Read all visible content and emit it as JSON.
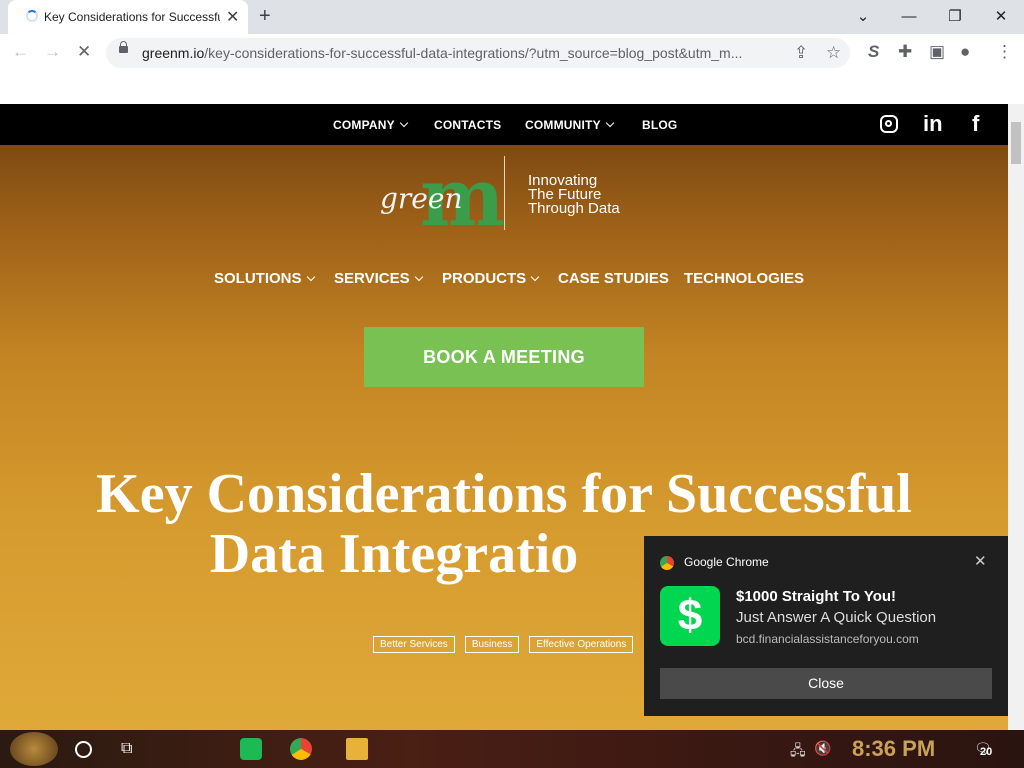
{
  "browser": {
    "tab_title": "Key Considerations for Successful Data Integrations",
    "new_tab": "+",
    "tab_close": "✕",
    "window": {
      "minimize": "—",
      "restore": "❐",
      "close": "✕",
      "tabsearch": "⌄"
    },
    "url_host": "greenm.io",
    "url_path": "/key-considerations-for-successful-data-integrations/?utm_source=blog_post&utm_m..."
  },
  "site": {
    "topnav": {
      "company": "COMPANY",
      "contacts": "CONTACTS",
      "community": "COMMUNITY",
      "blog": "BLOG"
    },
    "logo": {
      "mark": "m",
      "word": "green",
      "tagline": [
        "Innovating",
        "The Future",
        "Through Data"
      ]
    },
    "mainnav": {
      "solutions": "SOLUTIONS",
      "services": "SERVICES",
      "products": "PRODUCTS",
      "case_studies": "CASE STUDIES",
      "technologies": "TECHNOLOGIES"
    },
    "cta": "BOOK A MEETING",
    "headline_line1": "Key Considerations for Successful",
    "headline_line2": "Data Integratio",
    "tags": [
      "Better Services",
      "Business",
      "Effective Operations"
    ],
    "social": {
      "linkedin": "in",
      "facebook": "f"
    }
  },
  "notification": {
    "app": "Google Chrome",
    "title": "$1000 Straight To You!",
    "body": "Just Answer A Quick Question",
    "source": "bcd.financialassistanceforyou.com",
    "close_label": "Close",
    "icon_symbol": "$"
  },
  "taskbar": {
    "time": "8:36 PM",
    "notification_count": "20"
  }
}
